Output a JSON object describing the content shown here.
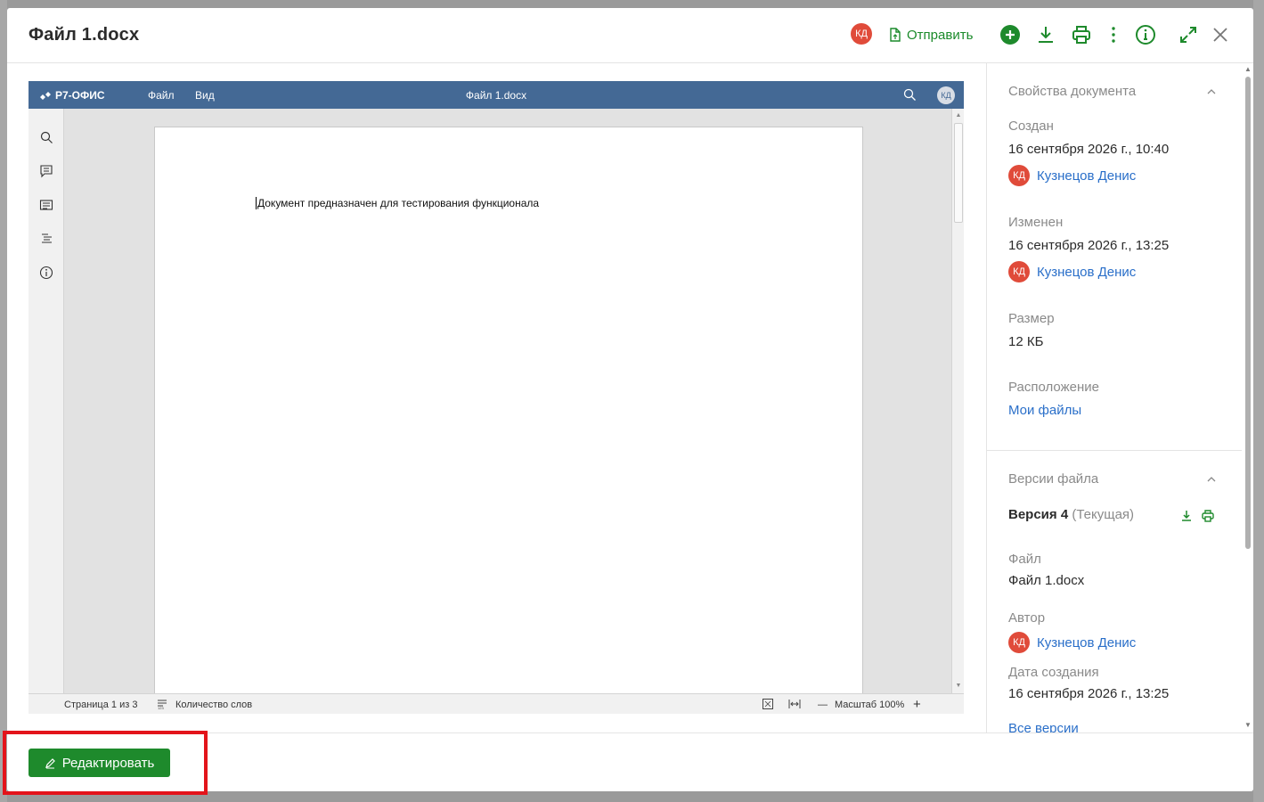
{
  "modal": {
    "title": "Файл 1.docx",
    "header": {
      "user_initials": "КД",
      "send_label": "Отправить",
      "icons": [
        "add-icon",
        "download-icon",
        "print-icon",
        "more-icon",
        "info-icon",
        "expand-icon",
        "close-icon"
      ]
    },
    "editor": {
      "brand": "Р7-ОФИС",
      "menu": [
        "Файл",
        "Вид"
      ],
      "doc_title": "Файл 1.docx",
      "user_initials": "КД",
      "body_text": "Документ предназначен для тестирования функционала",
      "status": {
        "page": "Страница 1 из 3",
        "word_count": "Количество слов",
        "zoom": "Масштаб 100%"
      }
    },
    "properties": {
      "title": "Свойства документа",
      "created_label": "Создан",
      "created_value": "16 сентября 2026 г., 10:40",
      "created_by": {
        "initials": "КД",
        "name": "Кузнецов Денис"
      },
      "modified_label": "Изменен",
      "modified_value": "16 сентября 2026 г., 13:25",
      "modified_by": {
        "initials": "КД",
        "name": "Кузнецов Денис"
      },
      "size_label": "Размер",
      "size_value": "12 КБ",
      "location_label": "Расположение",
      "location_value": "Мои файлы"
    },
    "versions": {
      "title": "Версии файла",
      "version_name": "Версия 4",
      "version_status": "(Текущая)",
      "file_label": "Файл",
      "file_value": "Файл 1.docx",
      "author_label": "Автор",
      "author": {
        "initials": "КД",
        "name": "Кузнецов Денис"
      },
      "date_label": "Дата создания",
      "date_value": "16 сентября 2026 г., 13:25",
      "all_versions_link": "Все версии"
    },
    "footer": {
      "edit_label": "Редактировать"
    }
  },
  "colors": {
    "accent_green": "#1e8a2c",
    "link_blue": "#2a6fc9",
    "avatar_red": "#e04b3a",
    "editor_toolbar": "#446995",
    "highlight_red": "#e3141b"
  }
}
